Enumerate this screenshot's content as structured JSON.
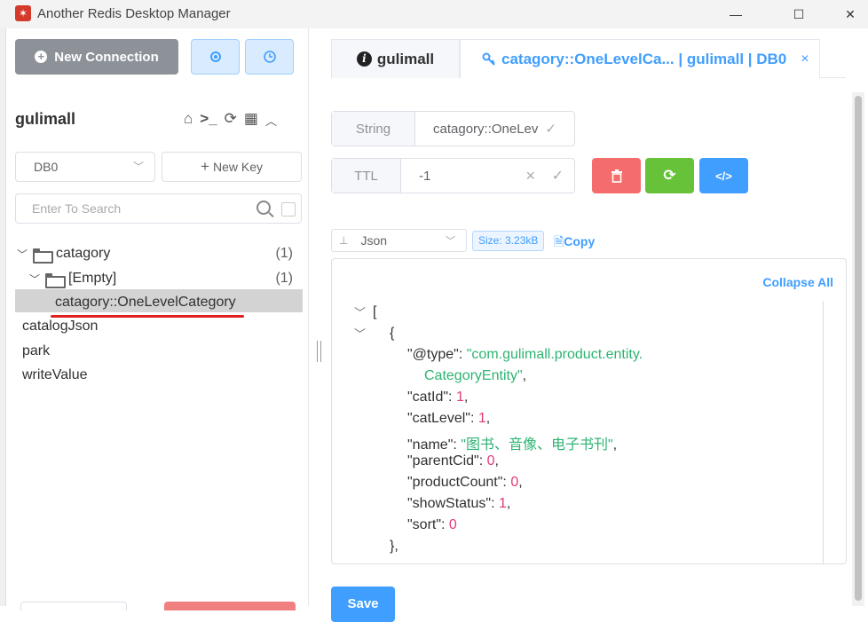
{
  "window": {
    "title": "Another Redis Desktop Manager",
    "minimize": "—",
    "maximize": "☐",
    "close": "✕"
  },
  "sidebar": {
    "new_connection_label": "New Connection",
    "connection_name": "gulimall",
    "db_select": "DB0",
    "new_key_label": "New Key",
    "search_placeholder": "Enter To Search",
    "tree": [
      {
        "label": "catagory",
        "count": "(1)"
      },
      {
        "label": "[Empty]",
        "count": "(1)"
      },
      {
        "label": "catagory::OneLevelCategory"
      },
      {
        "label": "catalogJson"
      },
      {
        "label": "park"
      },
      {
        "label": "writeValue"
      }
    ]
  },
  "tabs": {
    "info_label": "gulimall",
    "key_label": "catagory::OneLevelCa... | gulimall | DB0",
    "close": "×"
  },
  "key_detail": {
    "type_label": "String",
    "key_value": "catagory::OneLev",
    "ttl_label": "TTL",
    "ttl_value": "-1",
    "format": "Json",
    "size_badge": "Size: 3.23kB",
    "copy_label": "Copy",
    "collapse_all_label": "Collapse All",
    "save_label": "Save"
  },
  "json": {
    "open_bracket": "[",
    "open_brace": "{",
    "close_brace": "},",
    "type_key": "\"@type\"",
    "type_val_1": "\"com.gulimall.product.entity.",
    "type_val_2": "CategoryEntity\"",
    "catId_key": "\"catId\"",
    "catId_val": "1",
    "catLevel_key": "\"catLevel\"",
    "catLevel_val": "1",
    "name_key": "\"name\"",
    "name_val": "\"图书、音像、电子书刊\"",
    "parentCid_key": "\"parentCid\"",
    "parentCid_val": "0",
    "productCount_key": "\"productCount\"",
    "productCount_val": "0",
    "showStatus_key": "\"showStatus\"",
    "showStatus_val": "1",
    "sort_key": "\"sort\"",
    "sort_val": "0"
  },
  "colors": {
    "primary": "#409eff",
    "danger": "#f56c6c",
    "success": "#67c23a",
    "json_string": "#2db472",
    "json_number": "#e03c7a"
  }
}
